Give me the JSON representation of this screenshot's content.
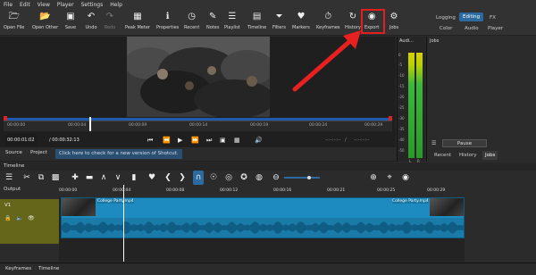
{
  "menubar": [
    "File",
    "Edit",
    "View",
    "Player",
    "Settings",
    "Help"
  ],
  "toolbar": {
    "items": [
      {
        "label": "Open File",
        "icon": "folder-icon"
      },
      {
        "label": "Open Other",
        "icon": "folder-open-icon"
      },
      {
        "label": "Save",
        "icon": "save-icon"
      },
      {
        "label": "Undo",
        "icon": "undo-icon"
      },
      {
        "label": "Redo",
        "icon": "redo-icon"
      },
      {
        "label": "Peak Meter",
        "icon": "meter-icon"
      },
      {
        "label": "Properties",
        "icon": "info-icon"
      },
      {
        "label": "Recent",
        "icon": "clock-icon"
      },
      {
        "label": "Notes",
        "icon": "notes-icon"
      },
      {
        "label": "Playlist",
        "icon": "playlist-icon"
      },
      {
        "label": "Timeline",
        "icon": "timeline-icon"
      },
      {
        "label": "Filters",
        "icon": "filter-icon"
      },
      {
        "label": "Markers",
        "icon": "marker-icon"
      },
      {
        "label": "Keyframes",
        "icon": "stopwatch-icon"
      },
      {
        "label": "History",
        "icon": "history-icon"
      },
      {
        "label": "Export",
        "icon": "export-icon"
      },
      {
        "label": "Jobs",
        "icon": "gear-icon"
      }
    ],
    "layouts_top": [
      "Logging",
      "Editing",
      "FX"
    ],
    "layouts_bottom": [
      "Color",
      "Audio",
      "Player"
    ],
    "active_layout": "Editing"
  },
  "player": {
    "ruler_ticks": [
      "00:00:00",
      "00:00:04",
      "00:00:09",
      "00:00:14",
      "00:00:19",
      "00:00:24",
      "00:00:29"
    ],
    "current_time": "00:00:01:02",
    "duration": "/ 00:00:32:13",
    "in_out_left": "--:--:--:--",
    "in_out_sep": "/",
    "in_out_right": "--:--:--:--",
    "tabs": [
      "Source",
      "Project"
    ],
    "update_note": "Click here to check for a new version of Shotcut."
  },
  "audio": {
    "title": "Audi...",
    "scale": [
      "0",
      "-5",
      "-10",
      "-15",
      "-20",
      "-25",
      "-30",
      "-35",
      "-40",
      "-50"
    ],
    "channels": [
      "L",
      "R"
    ]
  },
  "jobs": {
    "title": "Jobs",
    "pause_label": "Pause",
    "tabs": [
      "Recent",
      "History",
      "Jobs"
    ],
    "active_tab": "Jobs"
  },
  "timeline": {
    "title": "Timeline",
    "output_label": "Output",
    "track_name": "V1",
    "ticks": [
      "00:00:00",
      "00:00:04",
      "00:00:08",
      "00:00:12",
      "00:00:16",
      "00:00:21",
      "00:00:25",
      "00:00:29"
    ],
    "clip_label_start": "College Party.mp4",
    "clip_label_end": "College Party.mp4"
  },
  "bottom_tabs": [
    "Keyframes",
    "Timeline"
  ],
  "colors": {
    "accent": "#2d6a9f",
    "clip": "#1d8bbf",
    "highlight": "#e02020",
    "track_head": "#66661a"
  }
}
